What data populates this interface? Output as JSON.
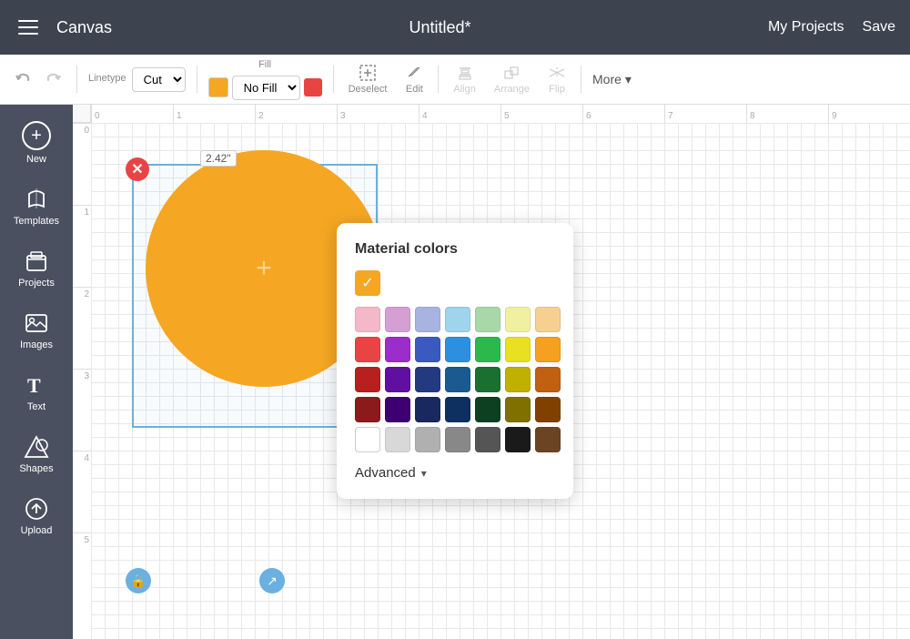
{
  "header": {
    "menu_icon": "≡",
    "app_name": "Canvas",
    "title": "Untitled*",
    "my_projects": "My Projects",
    "save": "Save"
  },
  "toolbar": {
    "linetype_label": "Linetype",
    "linetype_value": "Cut",
    "fill_label": "Fill",
    "fill_value": "No Fill",
    "deselect_label": "Deselect",
    "edit_label": "Edit",
    "align_label": "Align",
    "arrange_label": "Arrange",
    "flip_label": "Flip",
    "more_label": "More"
  },
  "sidebar": {
    "items": [
      {
        "id": "new",
        "label": "New",
        "icon": "+"
      },
      {
        "id": "templates",
        "label": "Templates",
        "icon": "👕"
      },
      {
        "id": "projects",
        "label": "Projects",
        "icon": "🗂"
      },
      {
        "id": "images",
        "label": "Images",
        "icon": "🖼"
      },
      {
        "id": "text",
        "label": "Text",
        "icon": "T"
      },
      {
        "id": "shapes",
        "label": "Shapes",
        "icon": "✦"
      },
      {
        "id": "upload",
        "label": "Upload",
        "icon": "⬆"
      }
    ]
  },
  "canvas": {
    "dimension_label": "2.42\"",
    "ruler_top": [
      "0",
      "1",
      "2",
      "3",
      "4",
      "5",
      "6",
      "7",
      "8",
      "9"
    ],
    "ruler_left": [
      "0",
      "1",
      "2",
      "3",
      "4",
      "5"
    ]
  },
  "color_picker": {
    "title": "Material colors",
    "advanced_label": "Advanced",
    "colors_row1": [
      "#f5b8c8",
      "#d4a0d4",
      "#a8b4e0",
      "#a0d4ec",
      "#a8d8a8",
      "#f0f0a0",
      "#f5d090"
    ],
    "colors_row2": [
      "#e84444",
      "#9b2dca",
      "#3b5abf",
      "#2d8fe0",
      "#2db84d",
      "#e8e020",
      "#f5a020"
    ],
    "colors_row3": [
      "#b82020",
      "#6010a0",
      "#243a80",
      "#1a5a90",
      "#1a7030",
      "#c0b000",
      "#c06010"
    ],
    "colors_row4": [
      "#8b1a1a",
      "#3d0070",
      "#1a2860",
      "#0d3060",
      "#0d4020",
      "#807000",
      "#804000"
    ],
    "colors_row5": [
      "#ffffff",
      "#d8d8d8",
      "#b0b0b0",
      "#888888",
      "#555555",
      "#1a1a1a",
      "#6b4423"
    ]
  }
}
